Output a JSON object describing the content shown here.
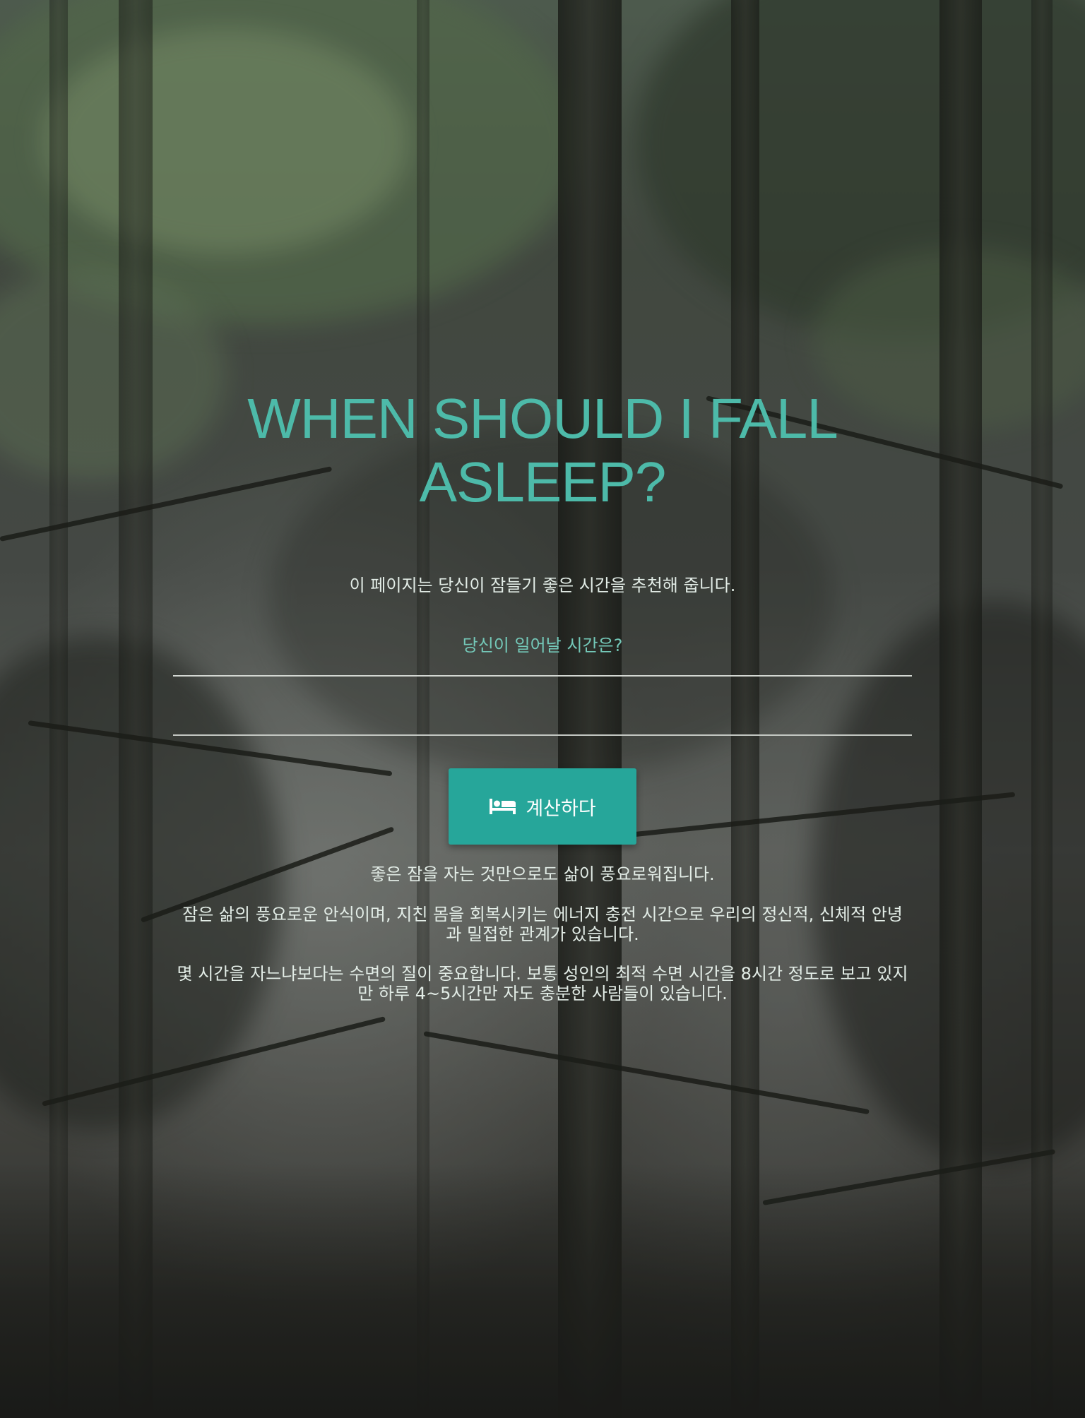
{
  "header": {
    "title": "WHEN SHOULD I FALL ASLEEP?",
    "intro": "이 페이지는 당신이 잠들기 좋은 시간을 추천해 줍니다."
  },
  "form": {
    "wake_question": "당신이 일어날 시간은?",
    "wake_time_value": "",
    "calculate_label": "계산하다",
    "calculate_icon": "bed-icon"
  },
  "info": {
    "paragraphs": [
      "좋은 잠을 자는 것만으로도 삶이 풍요로워집니다.",
      "잠은 삶의 풍요로운 안식이며, 지친 몸을 회복시키는 에너지 충전 시간으로 우리의 정신적, 신체적 안녕과 밀접한 관계가 있습니다.",
      "몇 시간을 자느냐보다는 수면의 질이 중요합니다. 보통 성인의 최적 수면 시간을 8시간 정도로 보고 있지만 하루 4~5시간만 자도 충분한 사람들이 있습니다."
    ]
  },
  "colors": {
    "accent": "#26a69a",
    "title": "#4dbaa9",
    "question": "#74c9b9",
    "text": "#e2ece6"
  }
}
